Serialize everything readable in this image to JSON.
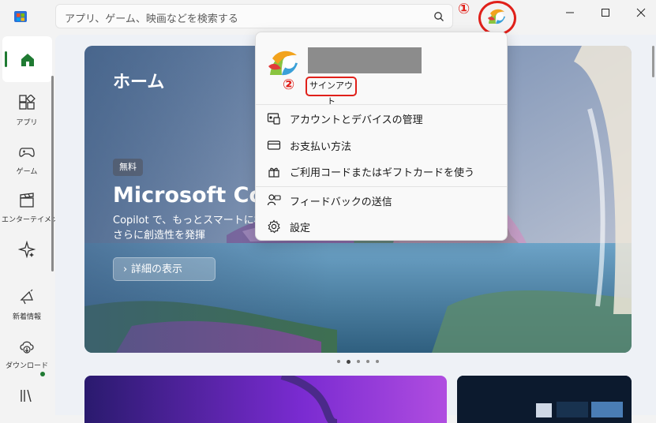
{
  "search": {
    "placeholder": "アプリ、ゲーム、映画などを検索する"
  },
  "annotations": {
    "step1": "①",
    "step2": "②"
  },
  "sidebar": {
    "items": [
      {
        "id": "home",
        "icon": "home-icon",
        "label": ""
      },
      {
        "id": "apps",
        "icon": "apps-icon",
        "label": "アプリ"
      },
      {
        "id": "games",
        "icon": "gamepad-icon",
        "label": "ゲーム"
      },
      {
        "id": "entertainment",
        "icon": "clapper-icon",
        "label": "エンターテイメント"
      },
      {
        "id": "ai",
        "icon": "sparkle-icon",
        "label": ""
      },
      {
        "id": "whatsnew",
        "icon": "megaphone-icon",
        "label": "新着情報"
      },
      {
        "id": "downloads",
        "icon": "cloud-download-icon",
        "label": "ダウンロード"
      },
      {
        "id": "library",
        "icon": "library-icon",
        "label": ""
      }
    ]
  },
  "hero": {
    "title": "ホーム",
    "badge": "無料",
    "product": "Microsoft Copilot",
    "description": "Copilot で、もっとスマートに検索、さらに創造性を発揮",
    "details_label": "詳細の表示"
  },
  "account_menu": {
    "signout_label": "サインアウト",
    "items": [
      {
        "icon": "account-devices-icon",
        "label": "アカウントとデバイスの管理"
      },
      {
        "icon": "credit-card-icon",
        "label": "お支払い方法"
      },
      {
        "icon": "gift-code-icon",
        "label": "ご利用コードまたはギフトカードを使う"
      },
      {
        "icon": "feedback-icon",
        "label": "フィードバックの送信"
      },
      {
        "icon": "settings-icon",
        "label": "設定"
      }
    ]
  },
  "colors": {
    "annotation_red": "#e0201a",
    "accent_green": "#1f7a32"
  }
}
